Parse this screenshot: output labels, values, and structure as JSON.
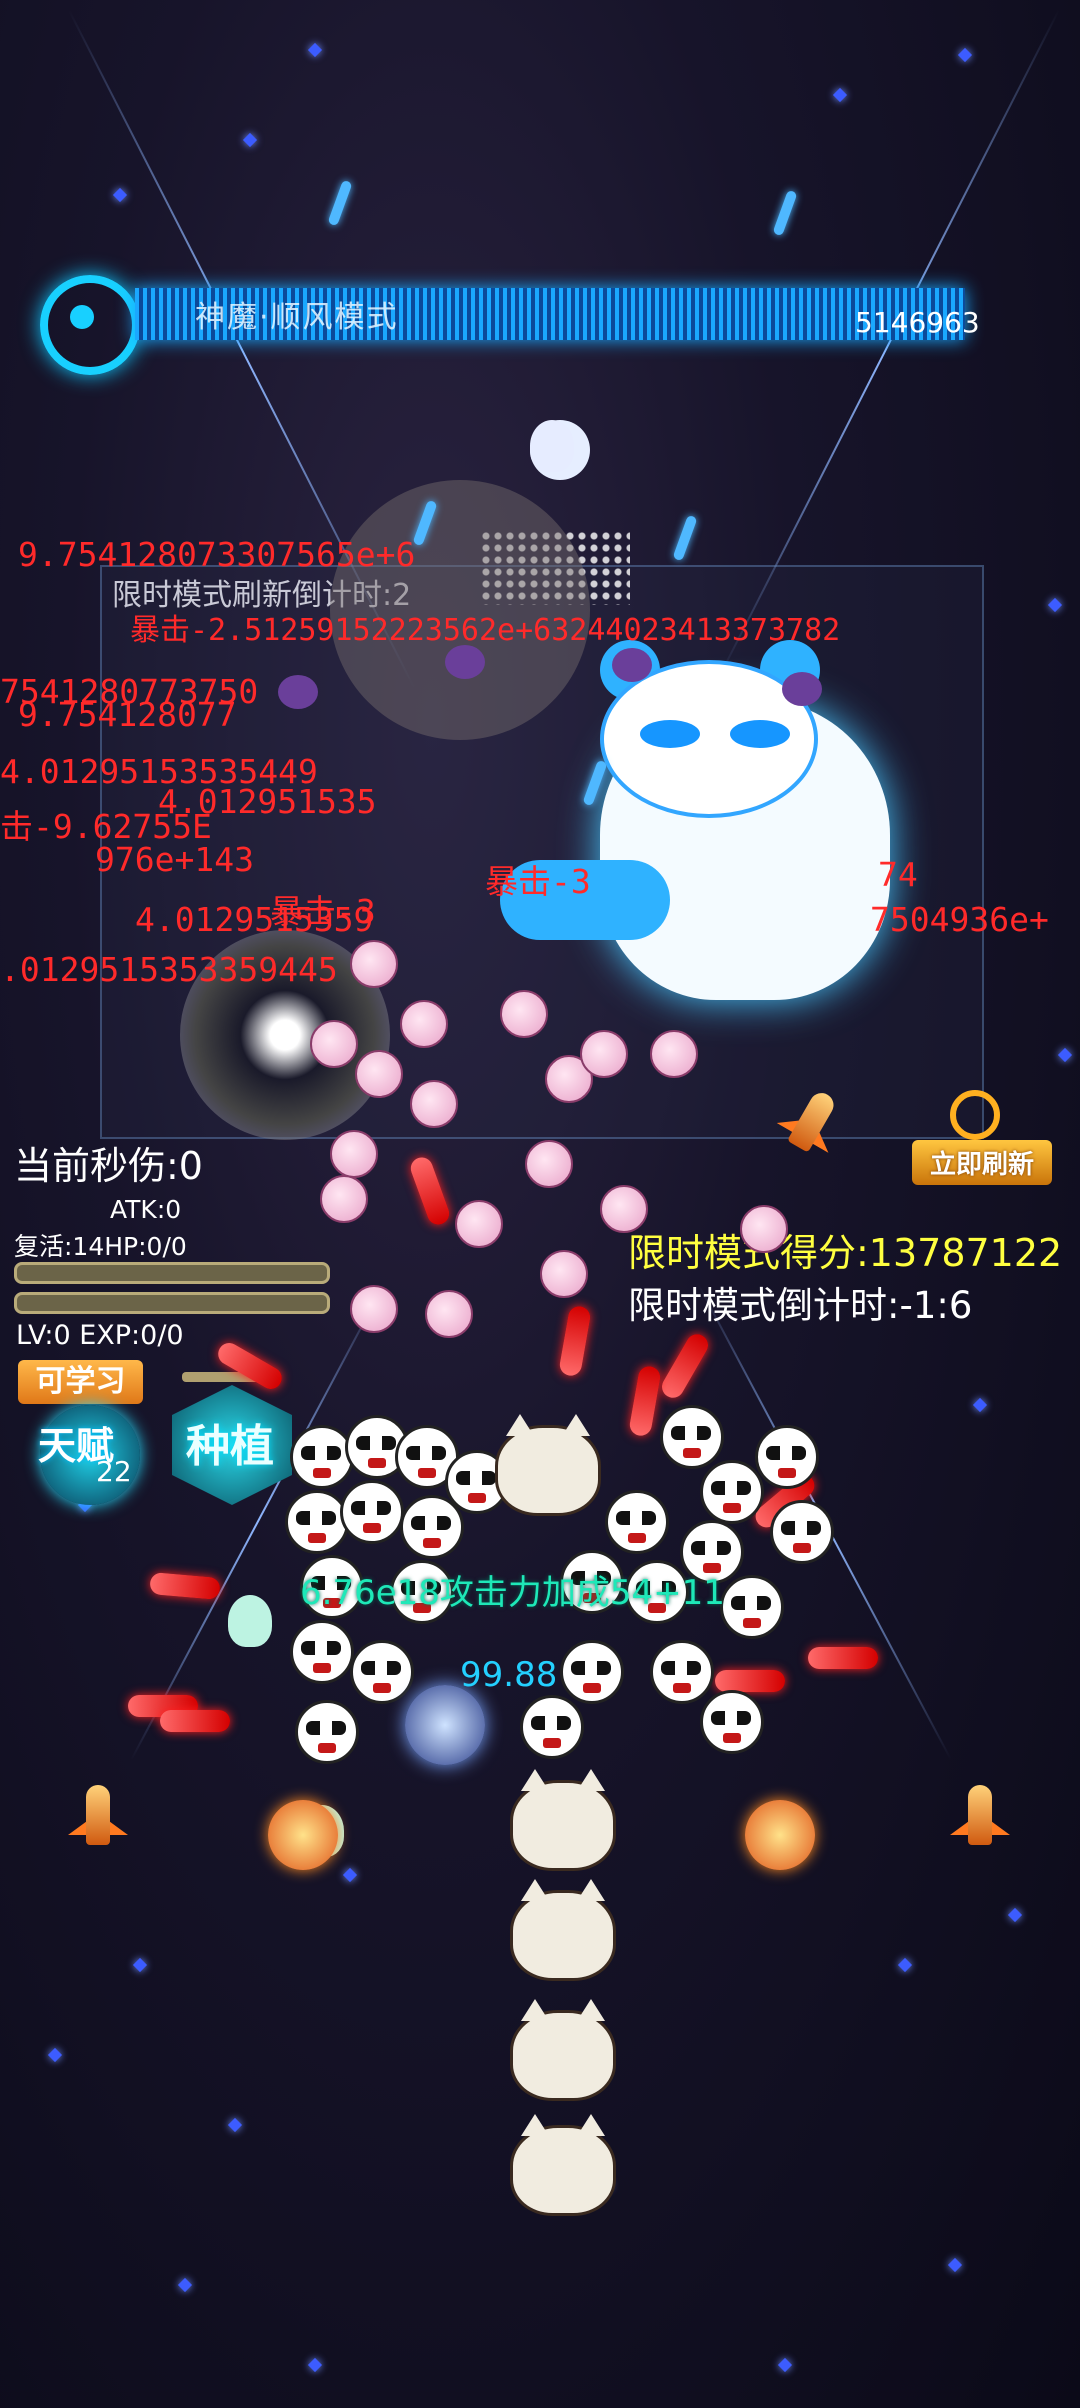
{
  "boss": {
    "name": "神魔·顺风模式",
    "hp_text": "5146963"
  },
  "limited_mode": {
    "refresh_countdown_label": "限时模式刷新倒计时:2",
    "score_text": "限时模式得分:13787122",
    "countdown_text": "限时模式倒计时:-1:6",
    "refresh_button_label": "立即刷新"
  },
  "player": {
    "dps_text": "当前秒伤:0",
    "atk_text": "ATK:0",
    "revive_hp_text": "复活:14HP:0/0",
    "lv_exp_text": "LV:0  EXP:0/0",
    "learnable_badge": "可学习",
    "talent_label": "天赋",
    "talent_count": "22",
    "plant_label": "种植"
  },
  "floating_damage": [
    "9.754128073307565e+6",
    "暴击-2.51259152223562e+63244023413373782",
    "7541280773750",
    "9.754128077",
    "4.01295153535449",
    "4.012951535",
    "击-9.62755E",
    "976e+143",
    "4.0129515359",
    "暴击-3",
    "7504936e+",
    ".0129515353359445",
    "74",
    "暴击-3"
  ],
  "floating_heal": [
    "6.76e18攻击力加成54+11",
    "99.88"
  ],
  "colors": {
    "boss_bar": "#1aa8ff",
    "damage_text": "#ff2a2a",
    "score_text": "#ffff40",
    "refresh_button": "#ffc640"
  }
}
